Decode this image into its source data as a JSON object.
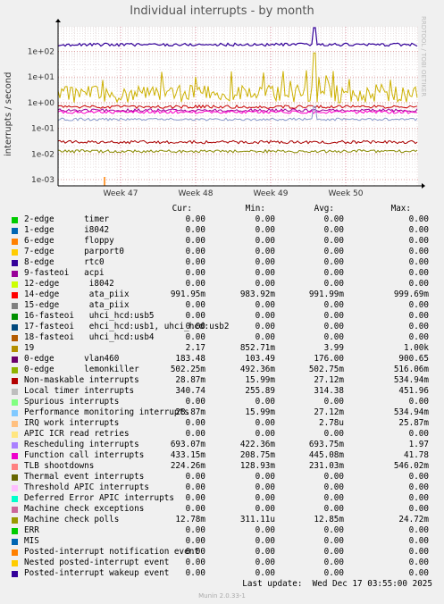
{
  "title": "Individual interrupts - by month",
  "side_text": "RRDTOOL / TOBI OETIKER",
  "footer": "Last update:  Wed Dec 17 03:55:00 2025",
  "munin": "Munin 2.0.33-1",
  "chart_data": {
    "type": "line",
    "ylabel": "interrupts / second",
    "y_scale": "log",
    "y_ticks": [
      "1e-03",
      "1e-02",
      "1e-01",
      "1e+00",
      "1e+01",
      "1e+02"
    ],
    "x_ticks": [
      "Week 47",
      "Week 48",
      "Week 49",
      "Week 50"
    ],
    "series": [
      {
        "name": "rtc0",
        "color": "#330099",
        "level": 183
      },
      {
        "name": "lemonkiller",
        "color": "#990099",
        "level": 0.5
      },
      {
        "name": "19",
        "color": "#ccb000",
        "level": 2.17
      },
      {
        "name": "Rescheduling interrupts",
        "color": "#cc0000",
        "level": 0.69
      },
      {
        "name": "Function call interrupts",
        "color": "#ff00cc",
        "level": 0.43
      },
      {
        "name": "Non-maskable interrupts",
        "color": "#aa0000",
        "level": 0.029
      },
      {
        "name": "Machine check polls",
        "color": "#888800",
        "level": 0.0128
      },
      {
        "name": "TLB shootdowns",
        "color": "#8899cc",
        "level": 0.224
      }
    ]
  },
  "legend": {
    "headers": [
      "Cur:",
      "Min:",
      "Avg:",
      "Max:"
    ],
    "rows": [
      {
        "color": "#00cc00",
        "name": "2-edge      timer",
        "cur": "0.00",
        "min": "0.00",
        "avg": "0.00",
        "max": "0.00"
      },
      {
        "color": "#0066b3",
        "name": "1-edge      i8042",
        "cur": "0.00",
        "min": "0.00",
        "avg": "0.00",
        "max": "0.00"
      },
      {
        "color": "#ff8000",
        "name": "6-edge      floppy",
        "cur": "0.00",
        "min": "0.00",
        "avg": "0.00",
        "max": "0.00"
      },
      {
        "color": "#ffcc00",
        "name": "7-edge      parport0",
        "cur": "0.00",
        "min": "0.00",
        "avg": "0.00",
        "max": "0.00"
      },
      {
        "color": "#330099",
        "name": "8-edge      rtc0",
        "cur": "0.00",
        "min": "0.00",
        "avg": "0.00",
        "max": "0.00"
      },
      {
        "color": "#990099",
        "name": "9-fasteoi   acpi",
        "cur": "0.00",
        "min": "0.00",
        "avg": "0.00",
        "max": "0.00"
      },
      {
        "color": "#ccff00",
        "name": "12-edge      i8042",
        "cur": "0.00",
        "min": "0.00",
        "avg": "0.00",
        "max": "0.00"
      },
      {
        "color": "#ff0000",
        "name": "14-edge      ata_piix",
        "cur": "991.95m",
        "min": "983.92m",
        "avg": "991.99m",
        "max": "999.69m"
      },
      {
        "color": "#808080",
        "name": "15-edge      ata_piix",
        "cur": "0.00",
        "min": "0.00",
        "avg": "0.00",
        "max": "0.00"
      },
      {
        "color": "#008f00",
        "name": "16-fasteoi   uhci_hcd:usb5",
        "cur": "0.00",
        "min": "0.00",
        "avg": "0.00",
        "max": "0.00"
      },
      {
        "color": "#00487d",
        "name": "17-fasteoi   ehci_hcd:usb1, uhci_hcd:usb2",
        "cur": "0.00",
        "min": "0.00",
        "avg": "0.00",
        "max": "0.00"
      },
      {
        "color": "#b35a00",
        "name": "18-fasteoi   uhci_hcd:usb4",
        "cur": "0.00",
        "min": "0.00",
        "avg": "0.00",
        "max": "0.00"
      },
      {
        "color": "#b38f00",
        "name": "19",
        "cur": "2.17",
        "min": "852.71m",
        "avg": "3.99",
        "max": "1.00k"
      },
      {
        "color": "#6b006b",
        "name": "0-edge      vlan460",
        "cur": "183.48",
        "min": "103.49",
        "avg": "176.00",
        "max": "900.65"
      },
      {
        "color": "#8fb300",
        "name": "0-edge      lemonkiller",
        "cur": "502.25m",
        "min": "492.36m",
        "avg": "502.75m",
        "max": "516.06m"
      },
      {
        "color": "#b30000",
        "name": "Non-maskable interrupts",
        "cur": "28.87m",
        "min": "15.99m",
        "avg": "27.12m",
        "max": "534.94m"
      },
      {
        "color": "#bebebe",
        "name": "Local timer interrupts",
        "cur": "340.74",
        "min": "255.89",
        "avg": "314.38",
        "max": "451.96"
      },
      {
        "color": "#80ff80",
        "name": "Spurious interrupts",
        "cur": "0.00",
        "min": "0.00",
        "avg": "0.00",
        "max": "0.00"
      },
      {
        "color": "#80c9ff",
        "name": "Performance monitoring interrupts",
        "cur": "28.87m",
        "min": "15.99m",
        "avg": "27.12m",
        "max": "534.94m"
      },
      {
        "color": "#ffc080",
        "name": "IRQ work interrupts",
        "cur": "0.00",
        "min": "0.00",
        "avg": "2.78u",
        "max": "25.87m"
      },
      {
        "color": "#ffe680",
        "name": "APIC ICR read retries",
        "cur": "0.00",
        "min": "0.00",
        "avg": "0.00",
        "max": "0.00"
      },
      {
        "color": "#aa80ff",
        "name": "Rescheduling interrupts",
        "cur": "693.07m",
        "min": "422.36m",
        "avg": "693.75m",
        "max": "1.97"
      },
      {
        "color": "#ee00cc",
        "name": "Function call interrupts",
        "cur": "433.15m",
        "min": "208.75m",
        "avg": "445.08m",
        "max": "41.78"
      },
      {
        "color": "#ff8080",
        "name": "TLB shootdowns",
        "cur": "224.26m",
        "min": "128.93m",
        "avg": "231.03m",
        "max": "546.02m"
      },
      {
        "color": "#666600",
        "name": "Thermal event interrupts",
        "cur": "0.00",
        "min": "0.00",
        "avg": "0.00",
        "max": "0.00"
      },
      {
        "color": "#ffbfff",
        "name": "Threshold APIC interrupts",
        "cur": "0.00",
        "min": "0.00",
        "avg": "0.00",
        "max": "0.00"
      },
      {
        "color": "#00ffcc",
        "name": "Deferred Error APIC interrupts",
        "cur": "0.00",
        "min": "0.00",
        "avg": "0.00",
        "max": "0.00"
      },
      {
        "color": "#cc6699",
        "name": "Machine check exceptions",
        "cur": "0.00",
        "min": "0.00",
        "avg": "0.00",
        "max": "0.00"
      },
      {
        "color": "#999900",
        "name": "Machine check polls",
        "cur": "12.78m",
        "min": "311.11u",
        "avg": "12.85m",
        "max": "24.72m"
      },
      {
        "color": "#00cc00",
        "name": "ERR",
        "cur": "0.00",
        "min": "0.00",
        "avg": "0.00",
        "max": "0.00"
      },
      {
        "color": "#0066b3",
        "name": "MIS",
        "cur": "0.00",
        "min": "0.00",
        "avg": "0.00",
        "max": "0.00"
      },
      {
        "color": "#ff8000",
        "name": "Posted-interrupt notification event",
        "cur": "0.00",
        "min": "0.00",
        "avg": "0.00",
        "max": "0.00"
      },
      {
        "color": "#ffcc00",
        "name": "Nested posted-interrupt event",
        "cur": "0.00",
        "min": "0.00",
        "avg": "0.00",
        "max": "0.00"
      },
      {
        "color": "#330099",
        "name": "Posted-interrupt wakeup event",
        "cur": "0.00",
        "min": "0.00",
        "avg": "0.00",
        "max": "0.00"
      }
    ]
  }
}
